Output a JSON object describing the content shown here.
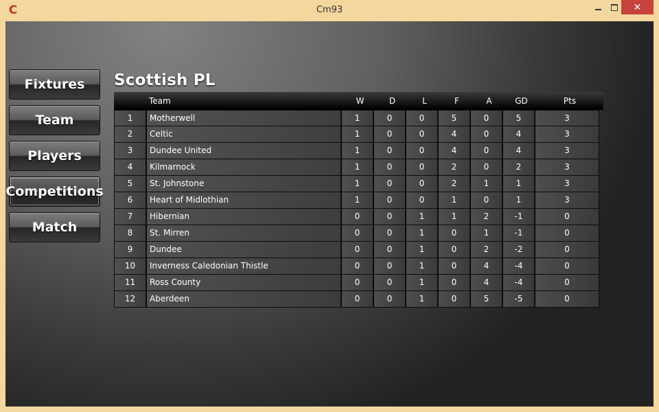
{
  "window": {
    "title": "Cm93",
    "app_icon_letter": "C",
    "controls": {
      "minimize": "minimize",
      "maximize": "maximize",
      "close": "✕"
    }
  },
  "nav": {
    "items": [
      {
        "label": "Fixtures",
        "active": false
      },
      {
        "label": "Team",
        "active": false
      },
      {
        "label": "Players",
        "active": false
      },
      {
        "label": "Competitions",
        "active": true
      },
      {
        "label": "Match",
        "active": false
      }
    ]
  },
  "league": {
    "title": "Scottish PL",
    "columns": [
      "",
      "Team",
      "W",
      "D",
      "L",
      "F",
      "A",
      "GD",
      "Pts"
    ],
    "rows": [
      {
        "pos": "1",
        "team": "Motherwell",
        "w": "1",
        "d": "0",
        "l": "0",
        "f": "5",
        "a": "0",
        "gd": "5",
        "pts": "3"
      },
      {
        "pos": "2",
        "team": "Celtic",
        "w": "1",
        "d": "0",
        "l": "0",
        "f": "4",
        "a": "0",
        "gd": "4",
        "pts": "3"
      },
      {
        "pos": "3",
        "team": "Dundee United",
        "w": "1",
        "d": "0",
        "l": "0",
        "f": "4",
        "a": "0",
        "gd": "4",
        "pts": "3"
      },
      {
        "pos": "4",
        "team": "Kilmarnock",
        "w": "1",
        "d": "0",
        "l": "0",
        "f": "2",
        "a": "0",
        "gd": "2",
        "pts": "3"
      },
      {
        "pos": "5",
        "team": "St. Johnstone",
        "w": "1",
        "d": "0",
        "l": "0",
        "f": "2",
        "a": "1",
        "gd": "1",
        "pts": "3"
      },
      {
        "pos": "6",
        "team": "Heart of Midlothian",
        "w": "1",
        "d": "0",
        "l": "0",
        "f": "1",
        "a": "0",
        "gd": "1",
        "pts": "3"
      },
      {
        "pos": "7",
        "team": "Hibernian",
        "w": "0",
        "d": "0",
        "l": "1",
        "f": "1",
        "a": "2",
        "gd": "-1",
        "pts": "0"
      },
      {
        "pos": "8",
        "team": "St. Mirren",
        "w": "0",
        "d": "0",
        "l": "1",
        "f": "0",
        "a": "1",
        "gd": "-1",
        "pts": "0"
      },
      {
        "pos": "9",
        "team": "Dundee",
        "w": "0",
        "d": "0",
        "l": "1",
        "f": "0",
        "a": "2",
        "gd": "-2",
        "pts": "0"
      },
      {
        "pos": "10",
        "team": "Inverness Caledonian Thistle",
        "w": "0",
        "d": "0",
        "l": "1",
        "f": "0",
        "a": "4",
        "gd": "-4",
        "pts": "0"
      },
      {
        "pos": "11",
        "team": "Ross County",
        "w": "0",
        "d": "0",
        "l": "1",
        "f": "0",
        "a": "4",
        "gd": "-4",
        "pts": "0"
      },
      {
        "pos": "12",
        "team": "Aberdeen",
        "w": "0",
        "d": "0",
        "l": "1",
        "f": "0",
        "a": "5",
        "gd": "-5",
        "pts": "0"
      }
    ]
  },
  "colors": {
    "window_frame": "#f3d79c",
    "close_button": "#c7423d",
    "app_icon": "#c0392b"
  }
}
